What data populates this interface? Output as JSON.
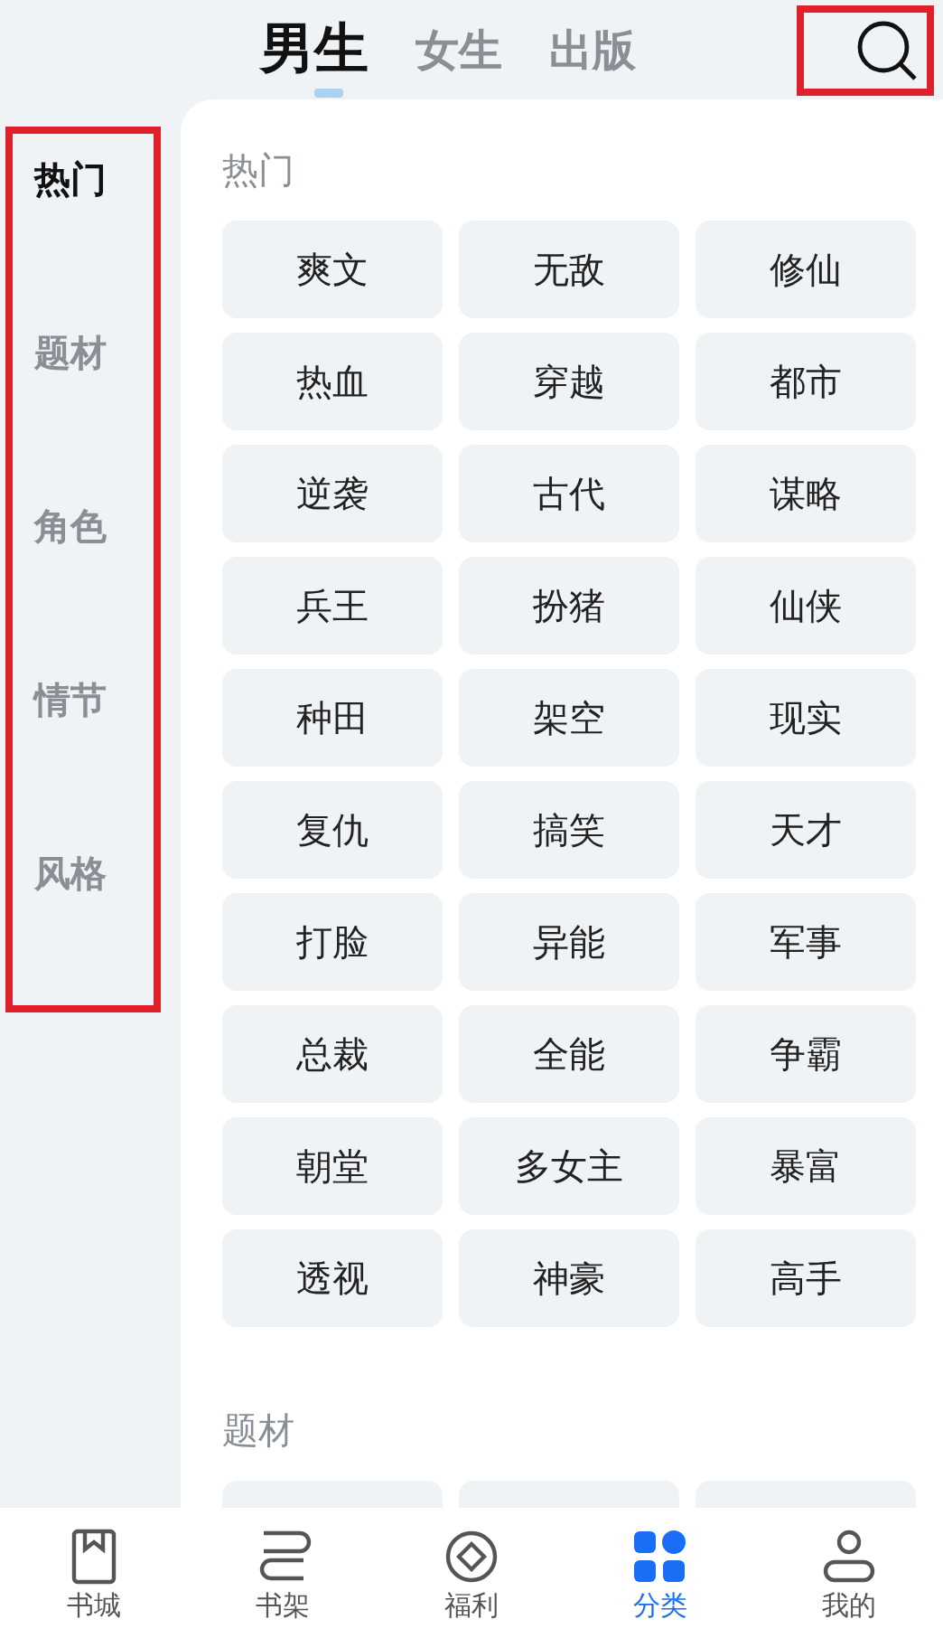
{
  "top_tabs": [
    {
      "label": "男生",
      "selected": true
    },
    {
      "label": "女生",
      "selected": false
    },
    {
      "label": "出版",
      "selected": false
    }
  ],
  "search": {
    "highlighted": true
  },
  "sidebar": {
    "highlighted": true,
    "items": [
      {
        "label": "热门",
        "selected": true
      },
      {
        "label": "题材",
        "selected": false
      },
      {
        "label": "角色",
        "selected": false
      },
      {
        "label": "情节",
        "selected": false
      },
      {
        "label": "风格",
        "selected": false
      }
    ]
  },
  "sections": [
    {
      "title": "热门",
      "kind": "full",
      "tags": [
        "爽文",
        "无敌",
        "修仙",
        "热血",
        "穿越",
        "都市",
        "逆袭",
        "古代",
        "谋略",
        "兵王",
        "扮猪",
        "仙侠",
        "种田",
        "架空",
        "现实",
        "复仇",
        "搞笑",
        "天才",
        "打脸",
        "异能",
        "军事",
        "总裁",
        "全能",
        "争霸",
        "朝堂",
        "多女主",
        "暴富",
        "透视",
        "神豪",
        "高手"
      ]
    },
    {
      "title": "题材",
      "kind": "cut"
    }
  ],
  "bottom_nav": [
    {
      "label": "书城",
      "selected": false
    },
    {
      "label": "书架",
      "selected": false
    },
    {
      "label": "福利",
      "selected": false
    },
    {
      "label": "分类",
      "selected": true
    },
    {
      "label": "我的",
      "selected": false
    }
  ]
}
